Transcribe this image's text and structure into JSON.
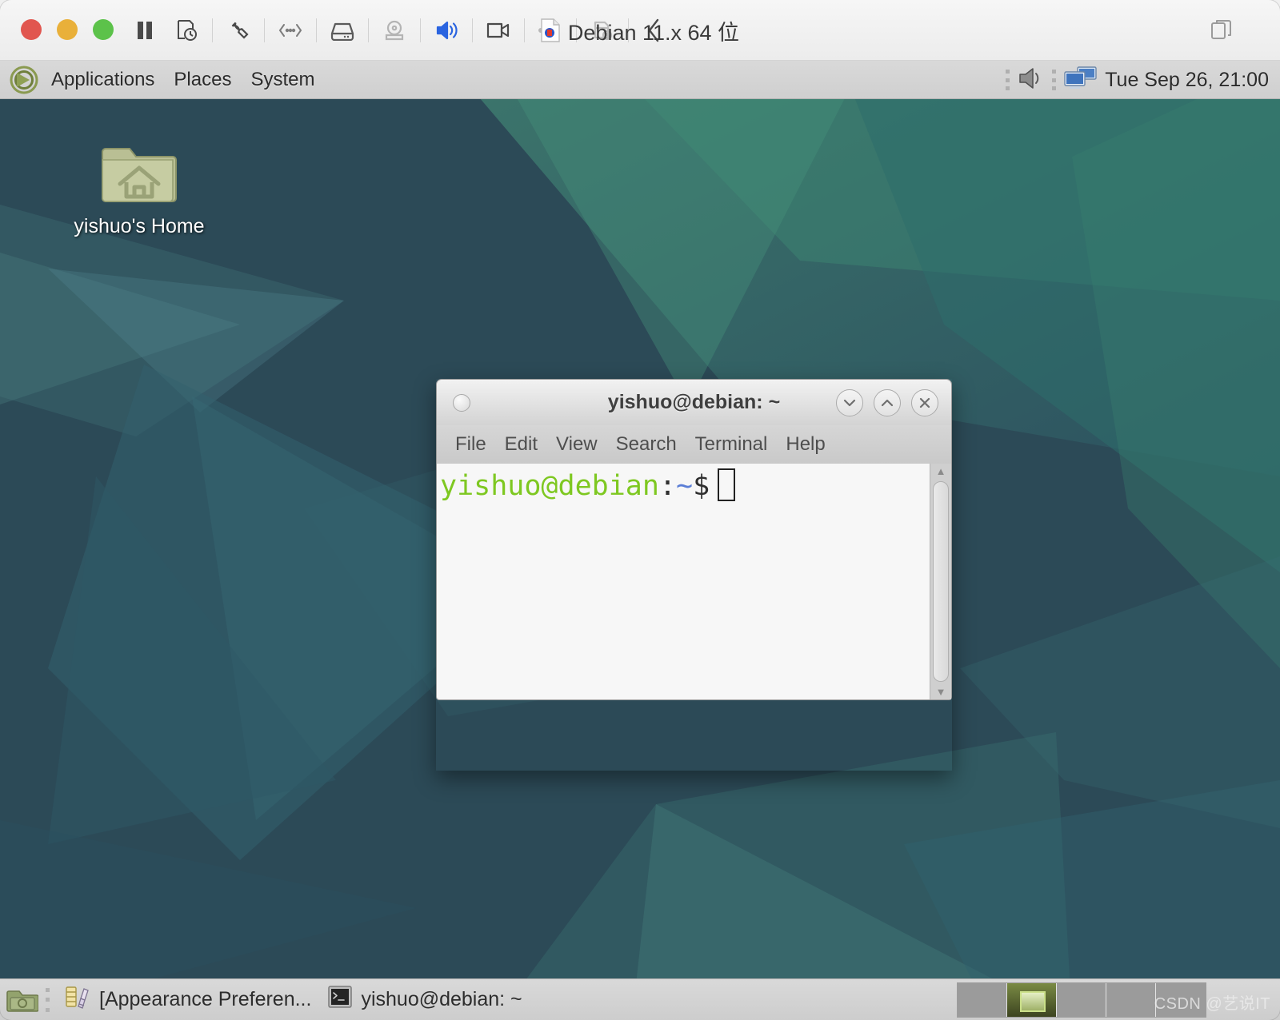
{
  "host": {
    "title": "Debian 11.x 64 位",
    "title_icon": "vm-document-icon",
    "traffic_lights": [
      {
        "name": "close-button",
        "color": "#e1564f"
      },
      {
        "name": "minimize-button",
        "color": "#e9b03a"
      },
      {
        "name": "fullscreen-button",
        "color": "#5cc24a"
      }
    ],
    "toolbar_icons": [
      {
        "name": "pause-icon",
        "glyph": "pause",
        "active": false
      },
      {
        "name": "snapshot-icon",
        "glyph": "snapshot",
        "active": false
      },
      {
        "name": "settings-wrench-icon",
        "glyph": "wrench",
        "active": false
      },
      {
        "name": "network-icon",
        "glyph": "network",
        "active": false
      },
      {
        "name": "hard-disk-icon",
        "glyph": "disk",
        "active": false
      },
      {
        "name": "cd-drive-icon",
        "glyph": "cd",
        "active": false
      },
      {
        "name": "sound-icon",
        "glyph": "speaker",
        "active": true
      },
      {
        "name": "camera-icon",
        "glyph": "camera",
        "active": false
      },
      {
        "name": "usb-icon",
        "glyph": "usb",
        "active": false
      },
      {
        "name": "printer-icon",
        "glyph": "printer",
        "active": false
      },
      {
        "name": "collapse-icon",
        "glyph": "chevron-left",
        "active": false
      }
    ],
    "window_tile_icon": "window-tile-icon"
  },
  "panel": {
    "logo": "debian-swirl-icon",
    "menus": [
      {
        "name": "menu-applications",
        "label": "Applications"
      },
      {
        "name": "menu-places",
        "label": "Places"
      },
      {
        "name": "menu-system",
        "label": "System"
      }
    ],
    "tray": [
      {
        "name": "volume-icon",
        "glyph": "speaker"
      },
      {
        "name": "network-monitor-icon",
        "glyph": "monitors"
      }
    ],
    "clock": "Tue Sep 26, 21:00"
  },
  "desktop": {
    "icons": [
      {
        "name": "home-folder-icon",
        "label": "yishuo's Home",
        "glyph": "home-folder"
      }
    ]
  },
  "terminal": {
    "title": "yishuo@debian: ~",
    "window_buttons": [
      {
        "name": "minimize-button",
        "glyph": "⌄"
      },
      {
        "name": "maximize-button",
        "glyph": "⌃"
      },
      {
        "name": "close-button",
        "glyph": "×"
      }
    ],
    "menu": [
      {
        "name": "terminal-menu-file",
        "label": "File"
      },
      {
        "name": "terminal-menu-edit",
        "label": "Edit"
      },
      {
        "name": "terminal-menu-view",
        "label": "View"
      },
      {
        "name": "terminal-menu-search",
        "label": "Search"
      },
      {
        "name": "terminal-menu-terminal",
        "label": "Terminal"
      },
      {
        "name": "terminal-menu-help",
        "label": "Help"
      }
    ],
    "prompt": {
      "user_host": "yishuo@debian",
      "colon": ":",
      "path": "~",
      "sigil": "$"
    },
    "colors": {
      "prompt_green": "#7ec821",
      "prompt_blue": "#5b7ed6",
      "background": "#f7f7f7"
    },
    "scrollbar": {
      "up_arrow": "▲",
      "down_arrow": "▼"
    }
  },
  "taskbar": {
    "show_desktop_icon": "show-desktop-icon",
    "items": [
      {
        "name": "taskbar-item-appearance",
        "icon": "appearance-prefs-icon",
        "label": "[Appearance Preferen..."
      },
      {
        "name": "taskbar-item-terminal",
        "icon": "terminal-icon",
        "label": "yishuo@debian: ~"
      }
    ],
    "workspaces": [
      {
        "name": "workspace-1",
        "active": false
      },
      {
        "name": "workspace-2",
        "active": true
      },
      {
        "name": "workspace-3",
        "active": false
      },
      {
        "name": "workspace-4",
        "active": false
      },
      {
        "name": "workspace-5",
        "active": false
      }
    ]
  },
  "watermark": "CSDN @艺说IT"
}
